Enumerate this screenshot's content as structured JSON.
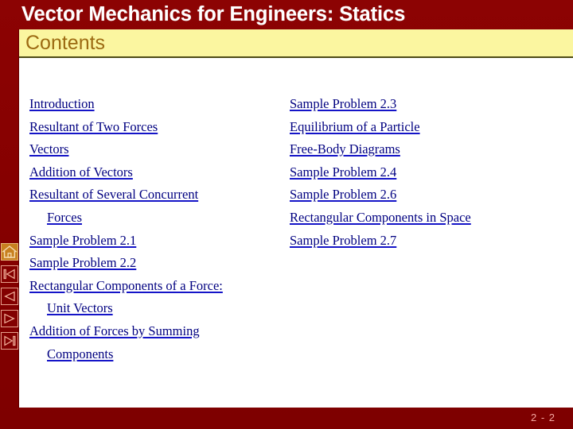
{
  "header": {
    "title": "Vector Mechanics for Engineers: Statics",
    "section_label": "Contents"
  },
  "colors": {
    "title_bar": "#8b0000",
    "contents_band": "#fbf6a0",
    "contents_text": "#9c6a12",
    "link": "#000080",
    "link_underline": "#1414c8",
    "page_number": "#f4a7a0",
    "home_icon_bg": "#c8801f"
  },
  "contents": {
    "left_column": [
      {
        "lines": [
          "Introduction"
        ]
      },
      {
        "lines": [
          "Resultant of Two Forces"
        ]
      },
      {
        "lines": [
          "Vectors"
        ]
      },
      {
        "lines": [
          "Addition of Vectors"
        ]
      },
      {
        "lines": [
          "Resultant of Several Concurrent",
          "Forces"
        ]
      },
      {
        "lines": [
          "Sample Problem 2.1"
        ]
      },
      {
        "lines": [
          "Sample Problem 2.2"
        ]
      },
      {
        "lines": [
          "Rectangular Components of a Force:",
          "Unit Vectors"
        ]
      },
      {
        "lines": [
          "Addition of Forces by Summing",
          "Components"
        ]
      }
    ],
    "right_column": [
      {
        "lines": [
          "Sample Problem 2.3"
        ]
      },
      {
        "lines": [
          "Equilibrium of a Particle"
        ]
      },
      {
        "lines": [
          "Free-Body Diagrams"
        ]
      },
      {
        "lines": [
          "Sample Problem 2.4"
        ]
      },
      {
        "lines": [
          "Sample Problem 2.6"
        ]
      },
      {
        "lines": [
          "Rectangular Components in Space"
        ]
      },
      {
        "lines": [
          "Sample Problem 2.7"
        ]
      }
    ]
  },
  "nav_rail": [
    {
      "name": "home-icon",
      "label": "Home"
    },
    {
      "name": "first-slide-icon",
      "label": "First"
    },
    {
      "name": "previous-slide-icon",
      "label": "Previous"
    },
    {
      "name": "next-slide-icon",
      "label": "Next"
    },
    {
      "name": "last-slide-icon",
      "label": "Last"
    }
  ],
  "footer": {
    "page_number": "2 - 2"
  }
}
